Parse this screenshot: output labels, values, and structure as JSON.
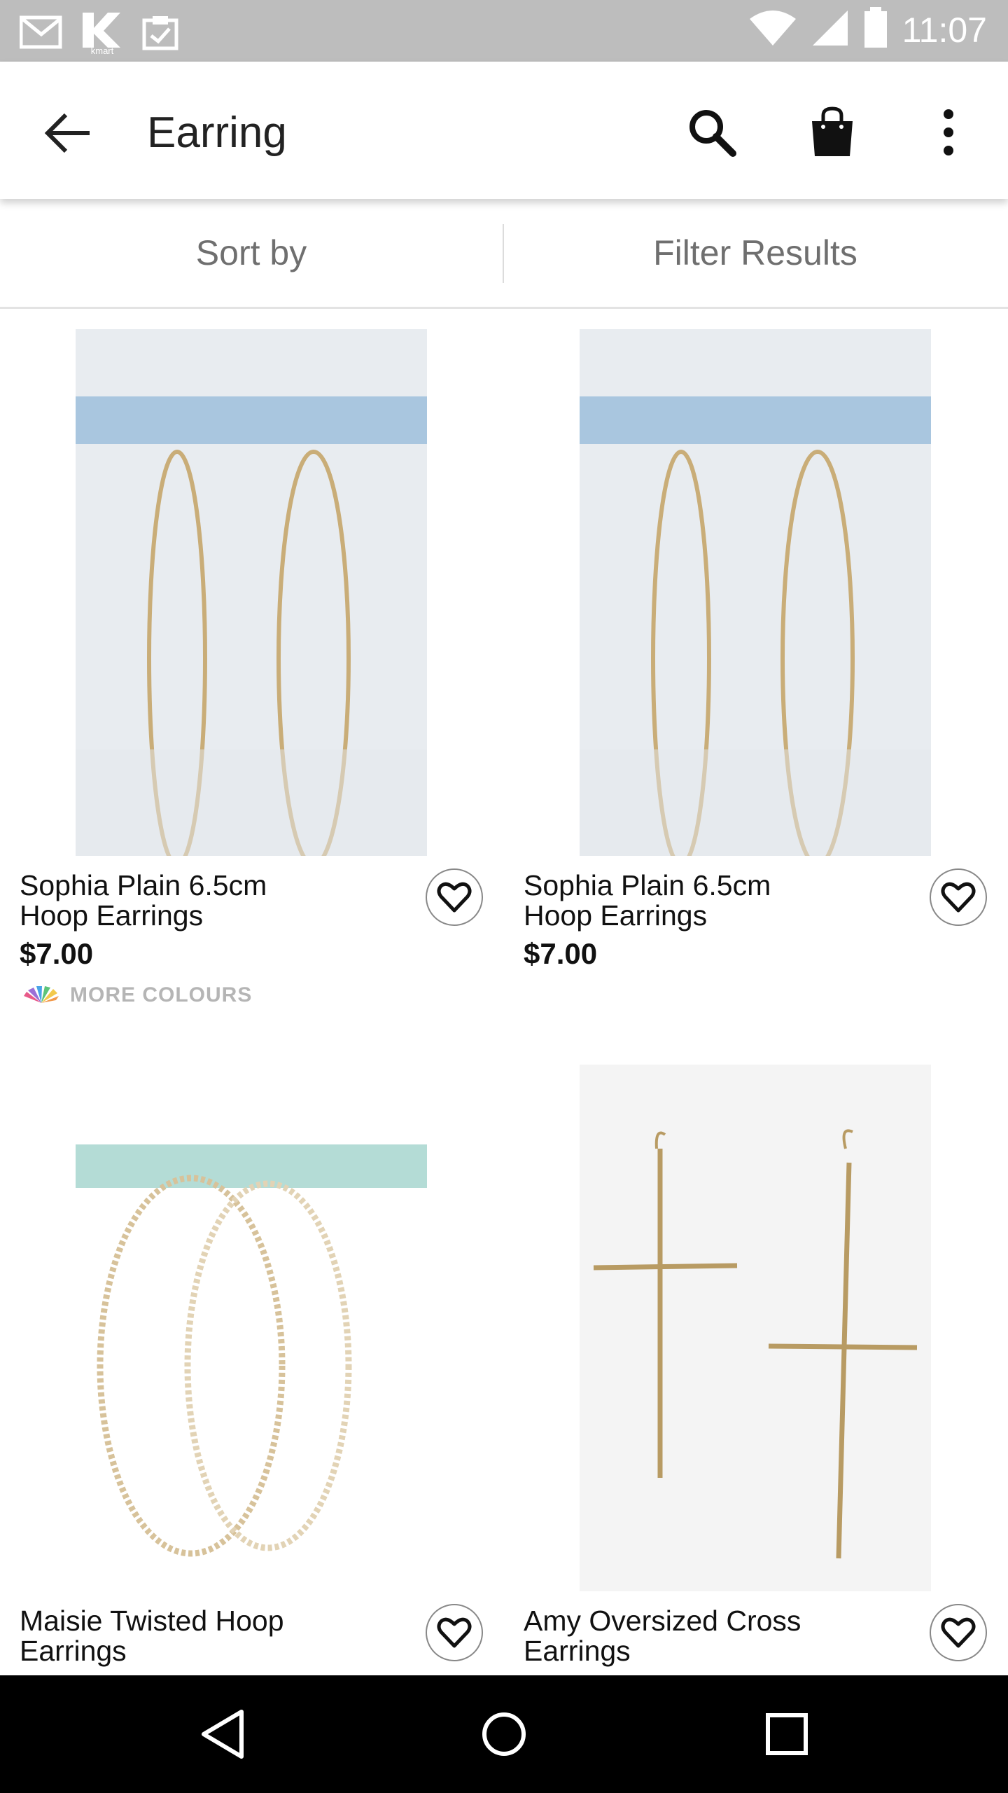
{
  "status_bar": {
    "time": "11:07",
    "notification_icons": [
      "gmail-icon",
      "kmart-icon",
      "clipboard-check-icon"
    ],
    "system_icons": [
      "wifi-icon",
      "signal-icon",
      "battery-icon"
    ]
  },
  "app_bar": {
    "title": "Earring",
    "icons": [
      "back-arrow-icon",
      "search-icon",
      "shopping-bag-icon",
      "more-vert-icon"
    ]
  },
  "sort_filter": {
    "sort_label": "Sort by",
    "filter_label": "Filter Results"
  },
  "products": [
    {
      "name_line1": "Sophia Plain 6.5cm",
      "name_line2": "Hoop Earrings",
      "price": "$7.00",
      "more_colours": "MORE COLOURS"
    },
    {
      "name_line1": "Sophia Plain 6.5cm",
      "name_line2": "Hoop Earrings",
      "price": "$7.00"
    },
    {
      "name_line1": "Maisie Twisted Hoop",
      "name_line2": "Earrings"
    },
    {
      "name_line1": "Amy Oversized Cross",
      "name_line2": "Earrings"
    }
  ],
  "nav_bar": {
    "icons": [
      "nav-back-icon",
      "nav-home-icon",
      "nav-recents-icon"
    ]
  }
}
